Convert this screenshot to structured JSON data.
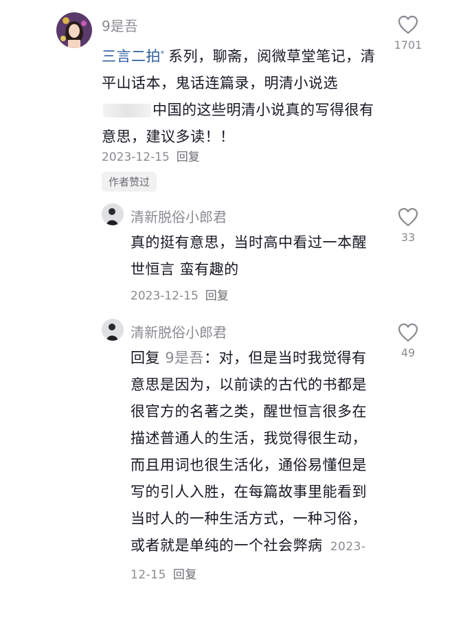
{
  "comments": [
    {
      "user": "9是吾",
      "link_text": "三言二拍",
      "body_after_link": "系列，聊斋，阅微草堂笔记，清平山话本，鬼话连篇录，明清小说选",
      "body_after_redact": "中国的这些明清小说真的写得很有意思，建议多读！！",
      "date": "2023-12-15",
      "reply_label": "回复",
      "badge": "作者赞过",
      "likes": "1701"
    },
    {
      "user": "清新脱俗小郎君",
      "body": "真的挺有意思，当时高中看过一本醒世恒言 蛮有趣的",
      "date": "2023-12-15",
      "reply_label": "回复",
      "likes": "33"
    },
    {
      "user": "清新脱俗小郎君",
      "reply_prefix": "回复",
      "reply_to": "9是吾",
      "body": "：对，但是当时我觉得有意思是因为，以前读的古代的书都是很官方的名著之类，醒世恒言很多在描述普通人的生活，我觉得很生动，而且用词也很生活化，通俗易懂但是写的引人入胜，在每篇故事里能看到当时人的一种生活方式，一种习俗，或者就是单纯的一个社会弊病",
      "date": "2023-12-15",
      "reply_label": "回复",
      "likes": "49"
    }
  ],
  "icons": {
    "search_mark": "ᵠ"
  }
}
